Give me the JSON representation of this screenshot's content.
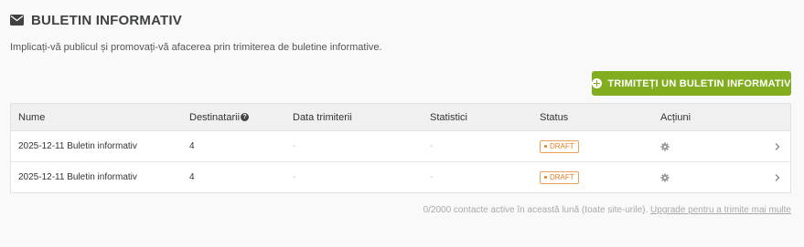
{
  "header": {
    "icon": "envelope-icon",
    "title": "BULETIN INFORMATIV",
    "subtitle": "Implicați-vă publicul și promovați-vă afacerea prin trimiterea de buletine informative."
  },
  "cta": {
    "icon": "plus-circle-icon",
    "label": "TRIMITEȚI UN BULETIN INFORMATIV",
    "color": "#82ad1f"
  },
  "table": {
    "columns": [
      "Nume",
      "Destinatarii",
      "Data trimiterii",
      "Statistici",
      "Status",
      "Acțiuni"
    ],
    "rows": [
      {
        "name": "2025-12-11 Buletin informativ",
        "recipients": "4",
        "sent_date": "-",
        "stats": "-",
        "status": "DRAFT"
      },
      {
        "name": "2025-12-11 Buletin informativ",
        "recipients": "4",
        "sent_date": "-",
        "stats": "-",
        "status": "DRAFT"
      }
    ]
  },
  "footer": {
    "text": "0/2000 contacte active în această lună (toate site-urile).",
    "link": "Upgrade pentru a trimite mai multe"
  },
  "colors": {
    "accent": "#82ad1f",
    "draft": "#e07d1d"
  }
}
